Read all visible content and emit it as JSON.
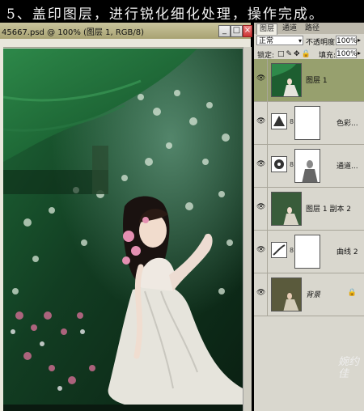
{
  "banner": {
    "caption": "5、盖印图层，进行锐化细化处理，操作完成。"
  },
  "document": {
    "title": "45667.psd @ 100% (图层 1, RGB/8)",
    "min_glyph": "_",
    "max_glyph": "□",
    "close_glyph": "×"
  },
  "panel": {
    "tabs": [
      "图层",
      "通道",
      "路径"
    ],
    "blend_mode": "正常",
    "opacity_label": "不透明度:",
    "opacity_value": "100%",
    "lock_label": "锁定:",
    "lock_icons": "□✎✥🔒",
    "fill_label": "填充:",
    "fill_value": "100%",
    "eye_glyph": "👁",
    "chain_glyph": "8",
    "lock_glyph": "🔒",
    "layers": [
      {
        "name": "图层 1",
        "kind": "pixel",
        "selected": true
      },
      {
        "name": "色彩...",
        "kind": "adjustment-color",
        "selected": false
      },
      {
        "name": "通道...",
        "kind": "adjustment-channel",
        "selected": false
      },
      {
        "name": "图层 1 副本 2",
        "kind": "pixel",
        "selected": false
      },
      {
        "name": "曲线 2",
        "kind": "adjustment-curves",
        "selected": false
      },
      {
        "name": "背景",
        "kind": "background",
        "selected": false
      }
    ]
  },
  "signature": "婉约佳"
}
